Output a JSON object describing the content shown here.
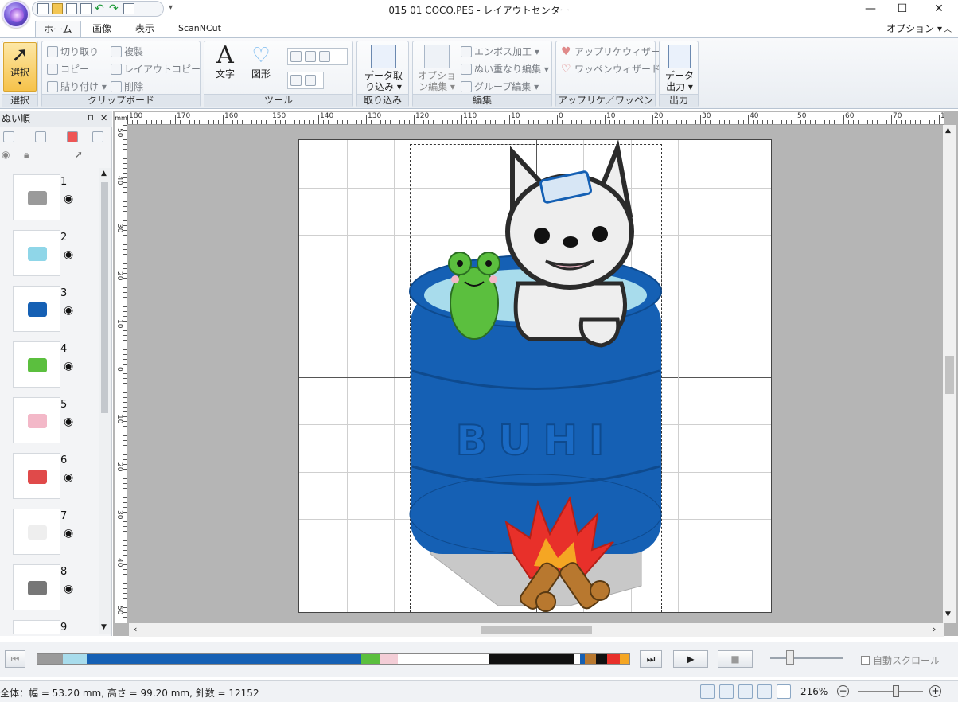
{
  "window": {
    "title": "015 01 COCO.PES - レイアウトセンター",
    "minimize": "—",
    "maximize": "☐",
    "close": "✕"
  },
  "quick_access": {
    "more": "▾"
  },
  "tabs": [
    "ホーム",
    "画像",
    "表示",
    "ScanNCut"
  ],
  "option_menu": "オプション ▾",
  "ribbon": {
    "select": {
      "label": "選択",
      "group": "選択"
    },
    "clipboard": {
      "group": "クリップボード",
      "cut": "切り取り",
      "copy": "コピー",
      "paste": "貼り付け ▾",
      "duplicate": "複製",
      "layout_copy": "レイアウトコピー ▾",
      "delete": "削除"
    },
    "tools": {
      "group": "ツール",
      "text": "文字",
      "shape": "図形"
    },
    "import": {
      "group": "取り込み",
      "data_import": "データ取り込み ▾"
    },
    "edit": {
      "group": "編集",
      "option_edit": "オプション編集 ▾",
      "emboss": "エンボス加工 ▾",
      "stitch_overlap": "ぬい重なり編集 ▾",
      "group_edit": "グループ編集 ▾"
    },
    "applique": {
      "group": "アップリケ／ワッペン",
      "applique_wizard": "アップリケウィザード",
      "patch_wizard": "ワッペンウィザード"
    },
    "output": {
      "group": "出力",
      "data_output": "データ出力 ▾"
    }
  },
  "sew_order": {
    "title": "ぬい順",
    "items": [
      {
        "num": "1",
        "color": "#9a9a9a"
      },
      {
        "num": "2",
        "color": "#8fd6e8"
      },
      {
        "num": "3",
        "color": "#1560b4"
      },
      {
        "num": "4",
        "color": "#5bbf3e"
      },
      {
        "num": "5",
        "color": "#f3b8c8"
      },
      {
        "num": "6",
        "color": "#e04a4a"
      },
      {
        "num": "7",
        "color": "#eeeeee"
      },
      {
        "num": "8",
        "color": "#777777"
      },
      {
        "num": "9",
        "color": "#111111"
      }
    ]
  },
  "rulers": {
    "h_labels": [
      "180",
      "170",
      "160",
      "150",
      "140",
      "130",
      "120",
      "110",
      "10",
      "0",
      "10",
      "20",
      "30",
      "40",
      "50",
      "60",
      "70",
      "180"
    ],
    "v_labels": [
      "50",
      "40",
      "30",
      "20",
      "10",
      "0",
      "10",
      "20",
      "30",
      "40",
      "50"
    ]
  },
  "design": {
    "barrel_text": "BUHI",
    "colors": {
      "barrel": "#1560b4",
      "water": "#a8dcec",
      "frog": "#5bbf3e",
      "dog_outline": "#2b2b2b",
      "flame": "#e8302a",
      "flame_inner": "#f5a623",
      "logs": "#b8782f",
      "stand": "#c8c8c8"
    }
  },
  "simulator": {
    "colors": [
      "#9a9a9a",
      "#a8dcec",
      "#1560b4",
      "#5bbf3e",
      "#f3cdd6",
      "#ffffff",
      "#111111",
      "#ffffff",
      "#1560b4",
      "#b8782f",
      "#111111",
      "#e8302a",
      "#f5a623"
    ],
    "widths": [
      32,
      30,
      346,
      24,
      22,
      116,
      106,
      8,
      6,
      14,
      14,
      16,
      12
    ],
    "auto_scroll": "自動スクロール"
  },
  "status": {
    "text": "全体：幅 = 53.20 mm, 高さ = 99.20 mm, 針数 = 12152",
    "zoom": "216%"
  }
}
